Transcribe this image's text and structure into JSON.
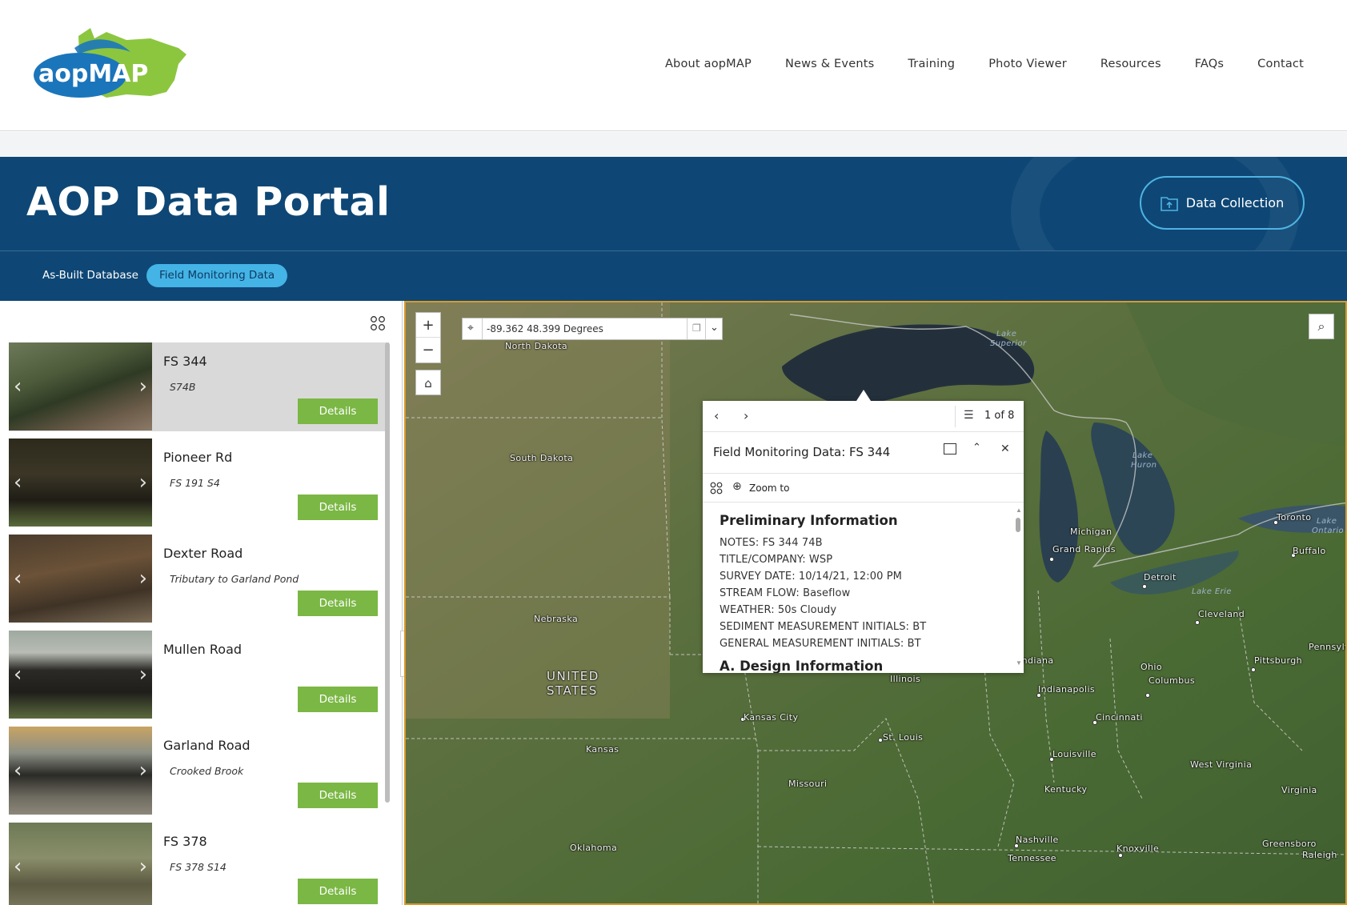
{
  "header": {
    "logo_text": "aopMAP",
    "nav": [
      "About aopMAP",
      "News & Events",
      "Training",
      "Photo Viewer",
      "Resources",
      "FAQs",
      "Contact"
    ]
  },
  "banner": {
    "title": "AOP Data Portal",
    "data_collection_label": "Data Collection"
  },
  "tabs": [
    "As-Built Database",
    "Field Monitoring Data"
  ],
  "list": {
    "items": [
      {
        "title": "FS 344",
        "subtitle": "S74B",
        "details": "Details"
      },
      {
        "title": "Pioneer Rd",
        "subtitle": "FS 191 S4",
        "details": "Details"
      },
      {
        "title": "Dexter Road",
        "subtitle": "Tributary to Garland Pond",
        "details": "Details"
      },
      {
        "title": "Mullen Road",
        "subtitle": "",
        "details": "Details"
      },
      {
        "title": "Garland Road",
        "subtitle": "Crooked Brook",
        "details": "Details"
      },
      {
        "title": "FS 378",
        "subtitle": "FS 378 S14",
        "details": "Details"
      }
    ]
  },
  "map": {
    "coordinates": "-89.362 48.399 Degrees",
    "labels": {
      "north_dakota": "North Dakota",
      "south_dakota": "South Dakota",
      "nebraska": "Nebraska",
      "kansas": "Kansas",
      "oklahoma": "Oklahoma",
      "missouri": "Missouri",
      "illinois": "Illinois",
      "indiana": "Indiana",
      "ohio": "Ohio",
      "michigan": "Michigan",
      "kentucky": "Kentucky",
      "tennessee": "Tennessee",
      "west_virginia": "West Virginia",
      "virginia": "Virginia",
      "pennsylvania": "Pennsylva",
      "united_states_1": "UNITED",
      "united_states_2": "STATES",
      "kansas_city": "Kansas City",
      "st_louis": "St. Louis",
      "indianapolis": "Indianapolis",
      "cincinnati": "Cincinnati",
      "louisville": "Louisville",
      "columbus": "Columbus",
      "cleveland": "Cleveland",
      "detroit": "Detroit",
      "grand_rapids": "Grand Rapids",
      "toronto": "Toronto",
      "buffalo": "Buffalo",
      "pittsburgh": "Pittsburgh",
      "nashville": "Nashville",
      "knoxville": "Knoxville",
      "greensboro": "Greensboro",
      "raleigh": "Raleigh",
      "lake_superior_1": "Lake",
      "lake_superior_2": "Superior",
      "lake_huron_1": "Lake",
      "lake_huron_2": "Huron",
      "lake_erie": "Lake Erie",
      "lake_ontario_1": "Lake",
      "lake_ontario_2": "Ontario"
    }
  },
  "popup": {
    "counter": "1 of 8",
    "title": "Field Monitoring Data: FS 344",
    "zoom_to": "Zoom to",
    "section1": "Preliminary Information",
    "lines": [
      "NOTES: FS 344 74B",
      "TITLE/COMPANY: WSP",
      "SURVEY DATE: 10/14/21, 12:00 PM",
      "STREAM FLOW: Baseflow",
      "WEATHER: 50s Cloudy",
      "SEDIMENT MEASUREMENT INITIALS: BT",
      "GENERAL MEASUREMENT INITIALS: BT"
    ],
    "section2": "A. Design Information"
  },
  "colors": {
    "brand_navy": "#0e4775",
    "accent_blue": "#44b3e6",
    "details_green": "#7ab744",
    "map_border": "#d99a2b"
  }
}
